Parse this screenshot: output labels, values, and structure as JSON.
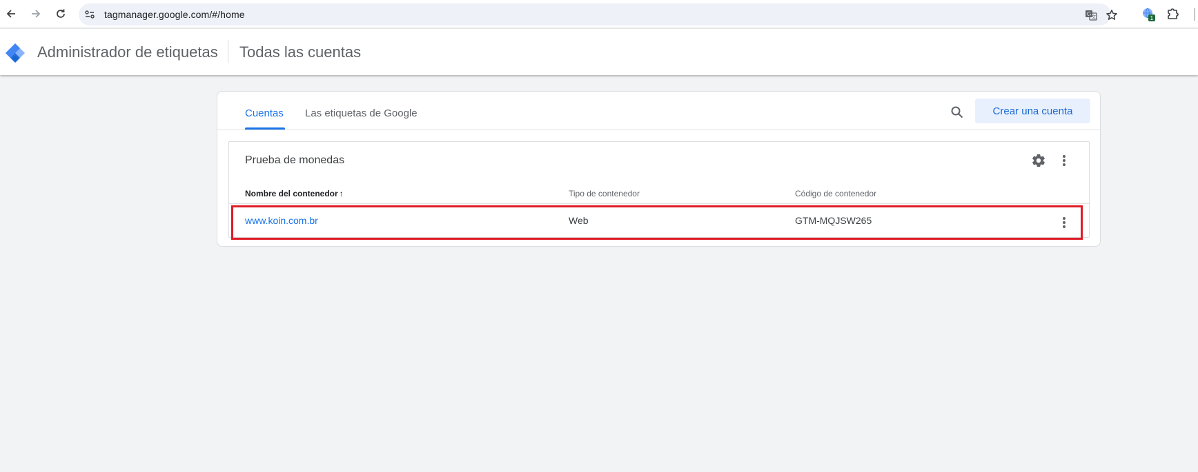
{
  "browser": {
    "url": "tagmanager.google.com/#/home",
    "extension_badge": "1"
  },
  "header": {
    "app_title": "Administrador de etiquetas",
    "page_title": "Todas las cuentas"
  },
  "tabs": [
    {
      "label": "Cuentas",
      "active": true
    },
    {
      "label": "Las etiquetas de Google",
      "active": false
    }
  ],
  "actions": {
    "create_account": "Crear una cuenta"
  },
  "account": {
    "name": "Prueba de monedas",
    "columns": [
      "Nombre del contenedor",
      "Tipo de contenedor",
      "Código de contenedor"
    ],
    "sort_indicator": "↑",
    "rows": [
      {
        "name": "www.koin.com.br",
        "type": "Web",
        "code": "GTM-MQJSW265"
      }
    ]
  },
  "colors": {
    "accent": "#1a73e8",
    "highlight": "#e01b24",
    "background": "#f1f3f4"
  }
}
